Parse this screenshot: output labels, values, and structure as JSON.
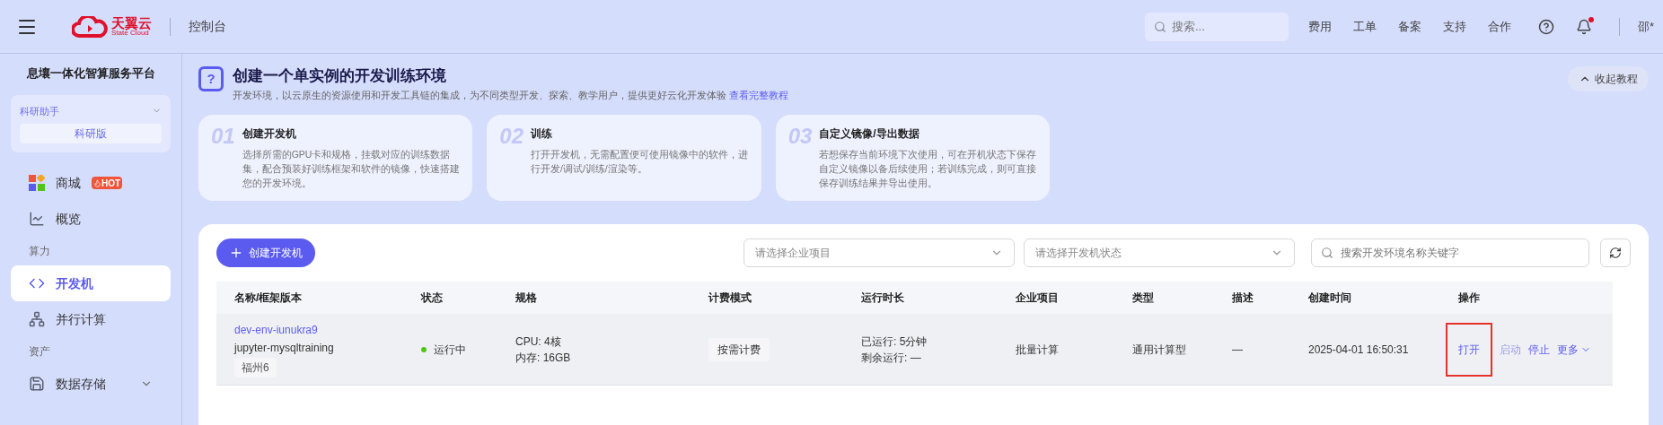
{
  "topbar": {
    "brand": "天翼云",
    "brand_sub": "State Cloud",
    "console": "控制台",
    "search": {
      "placeholder": "搜索..."
    },
    "links": [
      "费用",
      "工单",
      "备案",
      "支持",
      "合作"
    ],
    "notification_dot": true,
    "user": "邵*"
  },
  "sidebar": {
    "platform": "息壤一体化智算服务平台",
    "assistant": {
      "label": "科研助手",
      "edition": "科研版"
    },
    "items": [
      {
        "kind": "item",
        "label": "商城",
        "badge": "HOT",
        "selected": false
      },
      {
        "kind": "item",
        "label": "概览",
        "selected": false
      },
      {
        "kind": "section",
        "label": "算力"
      },
      {
        "kind": "item",
        "label": "开发机",
        "selected": true
      },
      {
        "kind": "item",
        "label": "并行计算",
        "selected": false
      },
      {
        "kind": "section",
        "label": "资产"
      },
      {
        "kind": "item",
        "label": "数据存储",
        "selected": false,
        "expandable": true
      }
    ]
  },
  "banner": {
    "glyph": "?",
    "title": "创建一个单实例的开发训练环境",
    "desc": "开发环境，以云原生的资源使用和开发工具链的集成，为不同类型开发、探索、教学用户，提供更好云化开发体验",
    "link": "查看完整教程",
    "collapse": "收起教程",
    "steps": [
      {
        "num": "01",
        "title": "创建开发机",
        "desc": "选择所需的GPU卡和规格，挂载对应的训练数据集，配合预装好训练框架和软件的镜像，快速搭建您的开发环境。"
      },
      {
        "num": "02",
        "title": "训练",
        "desc": "打开开发机，无需配置便可使用镜像中的软件，进行开发/调试/训练/渲染等。"
      },
      {
        "num": "03",
        "title": "自定义镜像/导出数据",
        "desc": "若想保存当前环境下次使用，可在开机状态下保存自定义镜像以备后续使用；若训练完成，则可直接保存训练结果并导出使用。"
      }
    ]
  },
  "toolbar": {
    "create": "创建开发机",
    "project_select": {
      "placeholder": "请选择企业项目"
    },
    "status_select": {
      "placeholder": "请选择开发机状态"
    },
    "search": {
      "placeholder": "搜索开发环境名称关键字"
    }
  },
  "table": {
    "columns": [
      "名称/框架版本",
      "状态",
      "规格",
      "计费模式",
      "运行时长",
      "企业项目",
      "类型",
      "描述",
      "创建时间",
      "操作"
    ],
    "rows": [
      {
        "name": "dev-env-iunukra9",
        "image": "jupyter-mysqltraining",
        "region": "福州6",
        "status": "运行中",
        "spec": [
          "CPU: 4核",
          "内存: 16GB"
        ],
        "billing": "按需计费",
        "runtime": [
          "已运行: 5分钟",
          "剩余运行: —"
        ],
        "project": "批量计算",
        "type": "通用计算型",
        "description": "—",
        "created": "2025-04-01 16:50:31",
        "actions": [
          {
            "label": "打开",
            "disabled": false,
            "highlighted": true,
            "dropdown": false
          },
          {
            "label": "启动",
            "disabled": true,
            "highlighted": false,
            "dropdown": false
          },
          {
            "label": "停止",
            "disabled": false,
            "highlighted": false,
            "dropdown": false
          },
          {
            "label": "更多",
            "disabled": false,
            "highlighted": false,
            "dropdown": true
          }
        ]
      }
    ]
  }
}
